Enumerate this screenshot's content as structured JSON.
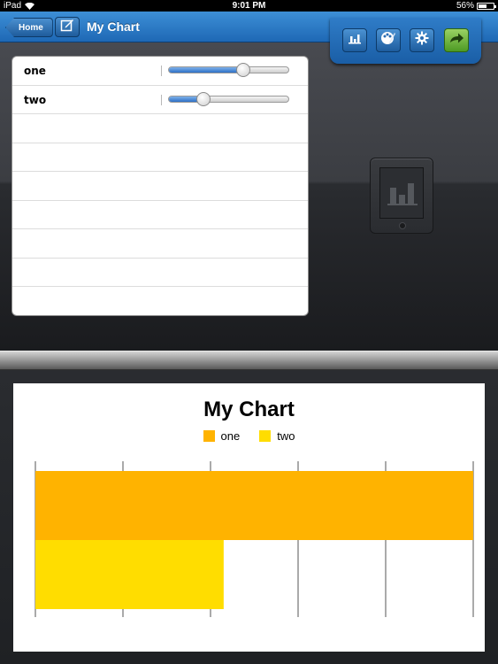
{
  "status_bar": {
    "device": "iPad",
    "time": "9:01 PM",
    "battery": "56%",
    "battery_level": 0.56
  },
  "nav": {
    "home_label": "Home",
    "title": "My Chart"
  },
  "toolbar": {
    "icons": [
      "bar-chart-icon",
      "palette-icon",
      "gear-icon",
      "share-arrow-icon"
    ]
  },
  "series_rows": [
    {
      "label": "one",
      "slider_value": 0.62
    },
    {
      "label": "two",
      "slider_value": 0.29
    }
  ],
  "empty_rows": 7,
  "colors": {
    "accent": "#2a78c8",
    "series_one": "#ffb300",
    "series_two": "#ffdd00"
  },
  "chart_data": {
    "type": "bar",
    "orientation": "horizontal",
    "title": "My Chart",
    "legend_position": "top",
    "series": [
      {
        "name": "one",
        "values": [
          1.0
        ],
        "color": "#ffb300"
      },
      {
        "name": "two",
        "values": [
          0.43
        ],
        "color": "#ffdd00"
      }
    ],
    "xlim": [
      0,
      1
    ],
    "grid": true,
    "gridlines": 6,
    "xlabel": "",
    "ylabel": ""
  }
}
